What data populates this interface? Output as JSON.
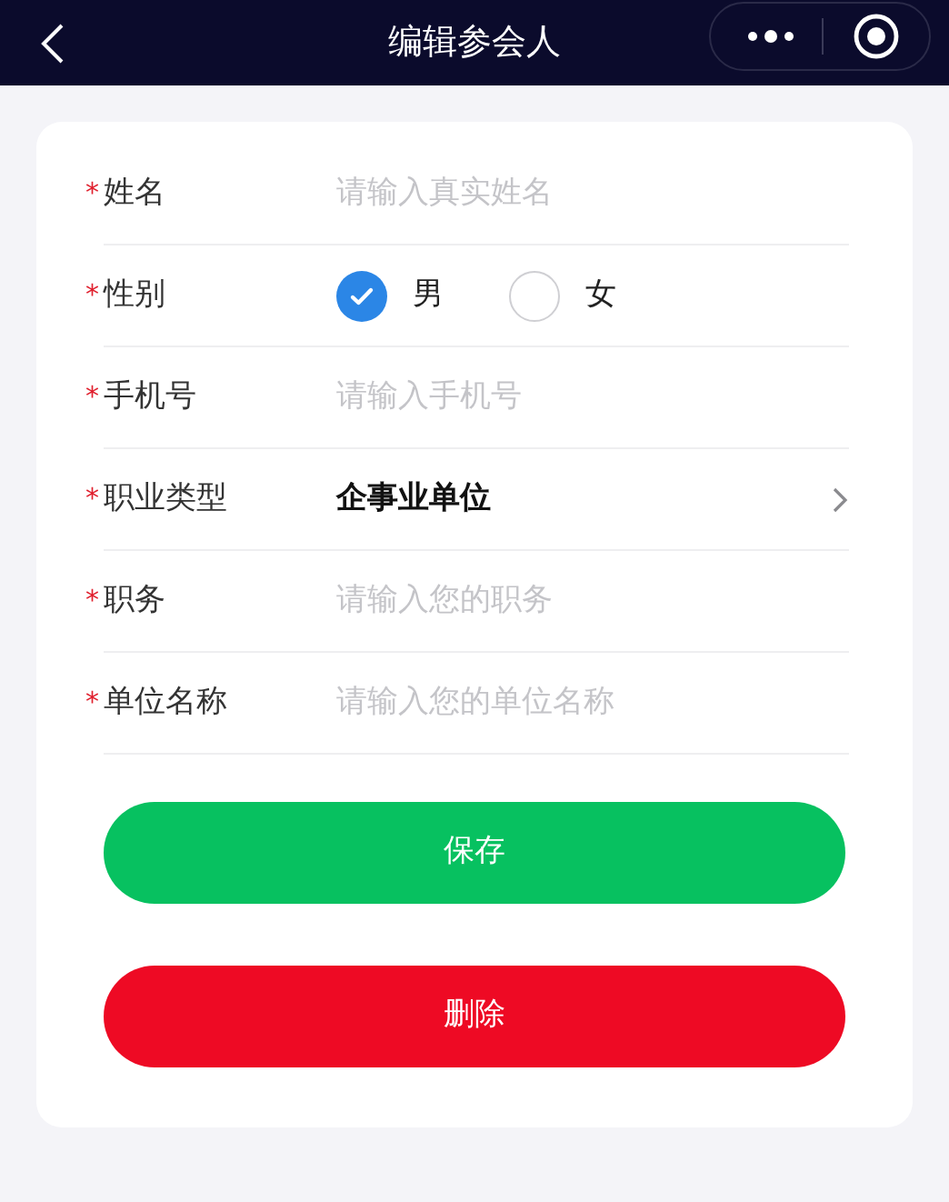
{
  "header": {
    "title": "编辑参会人"
  },
  "fields": [
    {
      "kind": "input",
      "required_mark": "*",
      "label": "姓名",
      "placeholder": "请输入真实姓名"
    },
    {
      "kind": "radio",
      "required_mark": "*",
      "label": "性别",
      "options": [
        {
          "label": "男",
          "selected": true
        },
        {
          "label": "女",
          "selected": false
        }
      ]
    },
    {
      "kind": "input",
      "required_mark": "*",
      "label": "手机号",
      "placeholder": "请输入手机号"
    },
    {
      "kind": "select",
      "required_mark": "*",
      "label": "职业类型",
      "value": "企事业单位"
    },
    {
      "kind": "input",
      "required_mark": "*",
      "label": "职务",
      "placeholder": "请输入您的职务"
    },
    {
      "kind": "input",
      "required_mark": "*",
      "label": "单位名称",
      "placeholder": "请输入您的单位名称"
    }
  ],
  "buttons": [
    {
      "kind": "save",
      "label": "保存"
    },
    {
      "kind": "delete",
      "label": "删除"
    }
  ]
}
